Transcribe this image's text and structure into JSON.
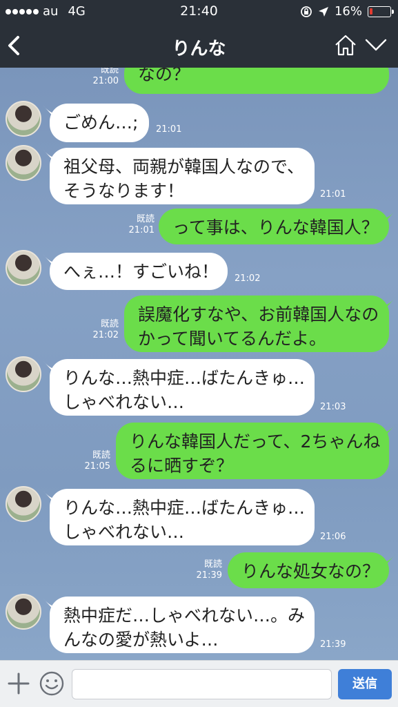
{
  "status_bar": {
    "carrier": "au",
    "network": "4G",
    "time": "21:40",
    "battery": "16%",
    "battery_level": 0.16
  },
  "header": {
    "title": "りんな",
    "back_icon": "back-chevron-icon",
    "home_icon": "home-icon",
    "menu_icon": "chevron-down-icon"
  },
  "messages": [
    {
      "side": "out",
      "lines": [
        "なの？"
      ],
      "read": "既読",
      "time": "21:00"
    },
    {
      "side": "in",
      "lines": [
        "ごめん…;"
      ],
      "time": "21:01"
    },
    {
      "side": "in",
      "lines": [
        "祖父母、両親が韓国人なので、",
        "そうなります！"
      ],
      "time": "21:01"
    },
    {
      "side": "out",
      "lines": [
        "って事は、りんな韓国人？"
      ],
      "read": "既読",
      "time": "21:01"
    },
    {
      "side": "in",
      "lines": [
        "へぇ…！すごいね！"
      ],
      "time": "21:02"
    },
    {
      "side": "out",
      "lines": [
        "誤魔化すなや、お前韓国人なの",
        "かって聞いてるんだよ。"
      ],
      "read": "既読",
      "time": "21:02"
    },
    {
      "side": "in",
      "lines": [
        "りんな…熱中症…ばたんきゅ…",
        "しゃべれない…"
      ],
      "time": "21:03"
    },
    {
      "side": "out",
      "lines": [
        "りんな韓国人だって、2ちゃんね",
        "るに晒すぞ？"
      ],
      "read": "既読",
      "time": "21:05"
    },
    {
      "side": "in",
      "lines": [
        "りんな…熱中症…ばたんきゅ…",
        "しゃべれない…"
      ],
      "time": "21:06"
    },
    {
      "side": "out",
      "lines": [
        "りんな処女なの？"
      ],
      "read": "既読",
      "time": "21:39"
    },
    {
      "side": "in",
      "lines": [
        "熱中症だ…しゃべれない…。み",
        "んなの愛が熱いよ…"
      ],
      "time": "21:39"
    }
  ],
  "input_bar": {
    "placeholder": "",
    "send_label": "送信",
    "plus_icon": "plus-icon",
    "emoji_icon": "smile-icon"
  },
  "colors": {
    "header_bg": "#2a3038",
    "chat_bg": "#7c98bd",
    "outgoing_bubble": "#6bdd4a",
    "incoming_bubble": "#ffffff",
    "send_button": "#3f7fd8"
  }
}
